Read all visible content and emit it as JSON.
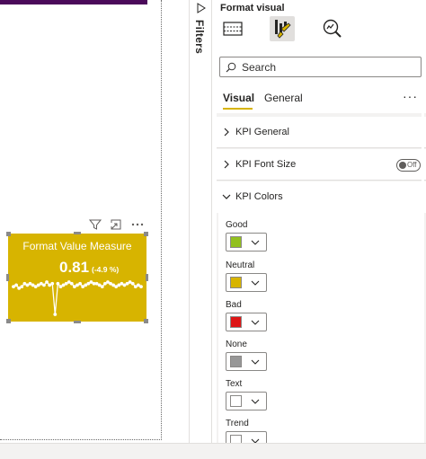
{
  "kpi": {
    "title": "Format Value Measure",
    "value": "0.81",
    "change": "(-4.9 %)",
    "background_color": "#d7b400",
    "trend_values": [
      12,
      11,
      13,
      12,
      10,
      11,
      10,
      11,
      12,
      11,
      10,
      11,
      9,
      11,
      10,
      30,
      10,
      12,
      11,
      10,
      9,
      10,
      12,
      11,
      10,
      12,
      11,
      10,
      9,
      10,
      10,
      11,
      12,
      10,
      9,
      10,
      11,
      12,
      11,
      10,
      11,
      10,
      9,
      10,
      12,
      11,
      12
    ]
  },
  "visual_header": {
    "filter_icon": "filter-icon",
    "focus_icon": "focus-mode-icon",
    "more_icon": "more-options-icon"
  },
  "filters_pane": {
    "label": "Filters"
  },
  "format_pane": {
    "title": "Format visual",
    "tabs": [
      {
        "icon": "table-icon",
        "active": false
      },
      {
        "icon": "format-paintbrush-icon",
        "active": true
      },
      {
        "icon": "analytics-icon",
        "active": false
      }
    ],
    "search_placeholder": "Search",
    "sub_tabs": {
      "visual": "Visual",
      "general": "General"
    },
    "more": "···",
    "sections": [
      {
        "label": "KPI General",
        "expanded": false
      },
      {
        "label": "KPI Font Size",
        "expanded": false,
        "toggle": "Off"
      },
      {
        "label": "KPI Colors",
        "expanded": true
      }
    ],
    "colors": [
      {
        "label": "Good",
        "color": "#92c01f"
      },
      {
        "label": "Neutral",
        "color": "#d7b400"
      },
      {
        "label": "Bad",
        "color": "#dd1616"
      },
      {
        "label": "None",
        "color": "#979797"
      },
      {
        "label": "Text",
        "color": "#ffffff"
      },
      {
        "label": "Trend",
        "color": "#ffffff"
      }
    ]
  }
}
